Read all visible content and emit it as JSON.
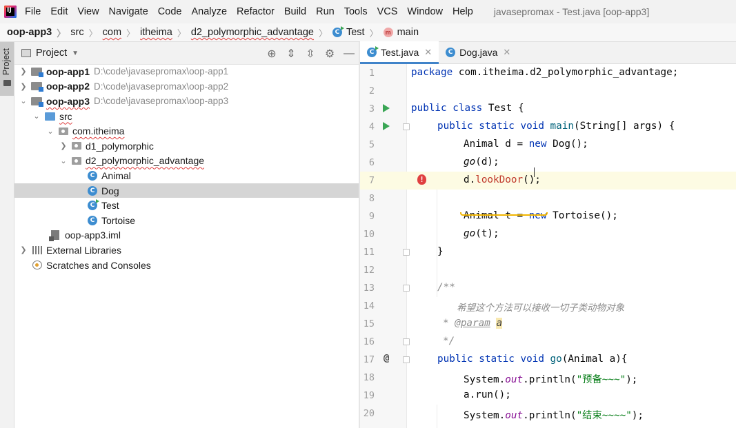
{
  "menubar": {
    "items": [
      "File",
      "Edit",
      "View",
      "Navigate",
      "Code",
      "Analyze",
      "Refactor",
      "Build",
      "Run",
      "Tools",
      "VCS",
      "Window",
      "Help"
    ],
    "window_title": "javasepromax - Test.java [oop-app3]"
  },
  "breadcrumb": [
    "oop-app3",
    "src",
    "com",
    "itheima",
    "d2_polymorphic_advantage",
    "Test",
    "main"
  ],
  "project_panel": {
    "title": "Project",
    "tree": [
      {
        "label": "oop-app1",
        "path": "D:\\code\\javasepromax\\oop-app1"
      },
      {
        "label": "oop-app2",
        "path": "D:\\code\\javasepromax\\oop-app2"
      },
      {
        "label": "oop-app3",
        "path": "D:\\code\\javasepromax\\oop-app3"
      },
      {
        "label": "src"
      },
      {
        "label": "com.itheima"
      },
      {
        "label": "d1_polymorphic"
      },
      {
        "label": "d2_polymorphic_advantage"
      },
      {
        "label": "Animal"
      },
      {
        "label": "Dog"
      },
      {
        "label": "Test"
      },
      {
        "label": "Tortoise"
      },
      {
        "label": "oop-app3.iml"
      },
      {
        "label": "External Libraries"
      },
      {
        "label": "Scratches and Consoles"
      }
    ]
  },
  "editor": {
    "tabs": [
      "Test.java",
      "Dog.java"
    ],
    "line_numbers": [
      "1",
      "2",
      "3",
      "4",
      "5",
      "6",
      "7",
      "8",
      "9",
      "10",
      "11",
      "12",
      "13",
      "14",
      "15",
      "16",
      "17",
      "18",
      "19",
      "20"
    ],
    "code": {
      "l1_kw": "package",
      "l1_rest": " com.itheima.d2_polymorphic_advantage;",
      "l3_kw": "public class",
      "l3_rest": " Test {",
      "l4_kw": "public static void",
      "l4_m": "main",
      "l4_rest": "(String[] args) {",
      "l5_a": "Animal d = ",
      "l5_kw": "new",
      "l5_b": " Dog();",
      "l6_m": "go",
      "l6_rest": "(d);",
      "l7_a": "d.",
      "l7_err": "lookDoor",
      "l7_b": "();",
      "l9_a": "Animal t = ",
      "l9_kw": "new",
      "l9_b": " Tortoise();",
      "l10_m": "go",
      "l10_rest": "(t);",
      "l11": "}",
      "l13": "/**",
      "l14": "希望这个方法可以接收一切子类动物对象",
      "l15_star": "* ",
      "l15_tag": "@param",
      "l15_p": "a",
      "l16": "*/",
      "l17_kw": "public static void",
      "l17_m": "go",
      "l17_rest": "(Animal a){",
      "l18_a": "System.",
      "l18_f": "out",
      "l18_b": ".println(",
      "l18_s": "\"预备~~~\"",
      "l18_c": ");",
      "l19": "a.run();",
      "l20_a": "System.",
      "l20_f": "out",
      "l20_b": ".println(",
      "l20_s": "\"结束~~~~\"",
      "l20_c": ");"
    }
  },
  "colors": {
    "keyword": "#0033b3",
    "method": "#00627a",
    "string": "#067d17",
    "comment": "#8c8c8c",
    "error": "#e04040",
    "selection": "#d5d5d5"
  }
}
